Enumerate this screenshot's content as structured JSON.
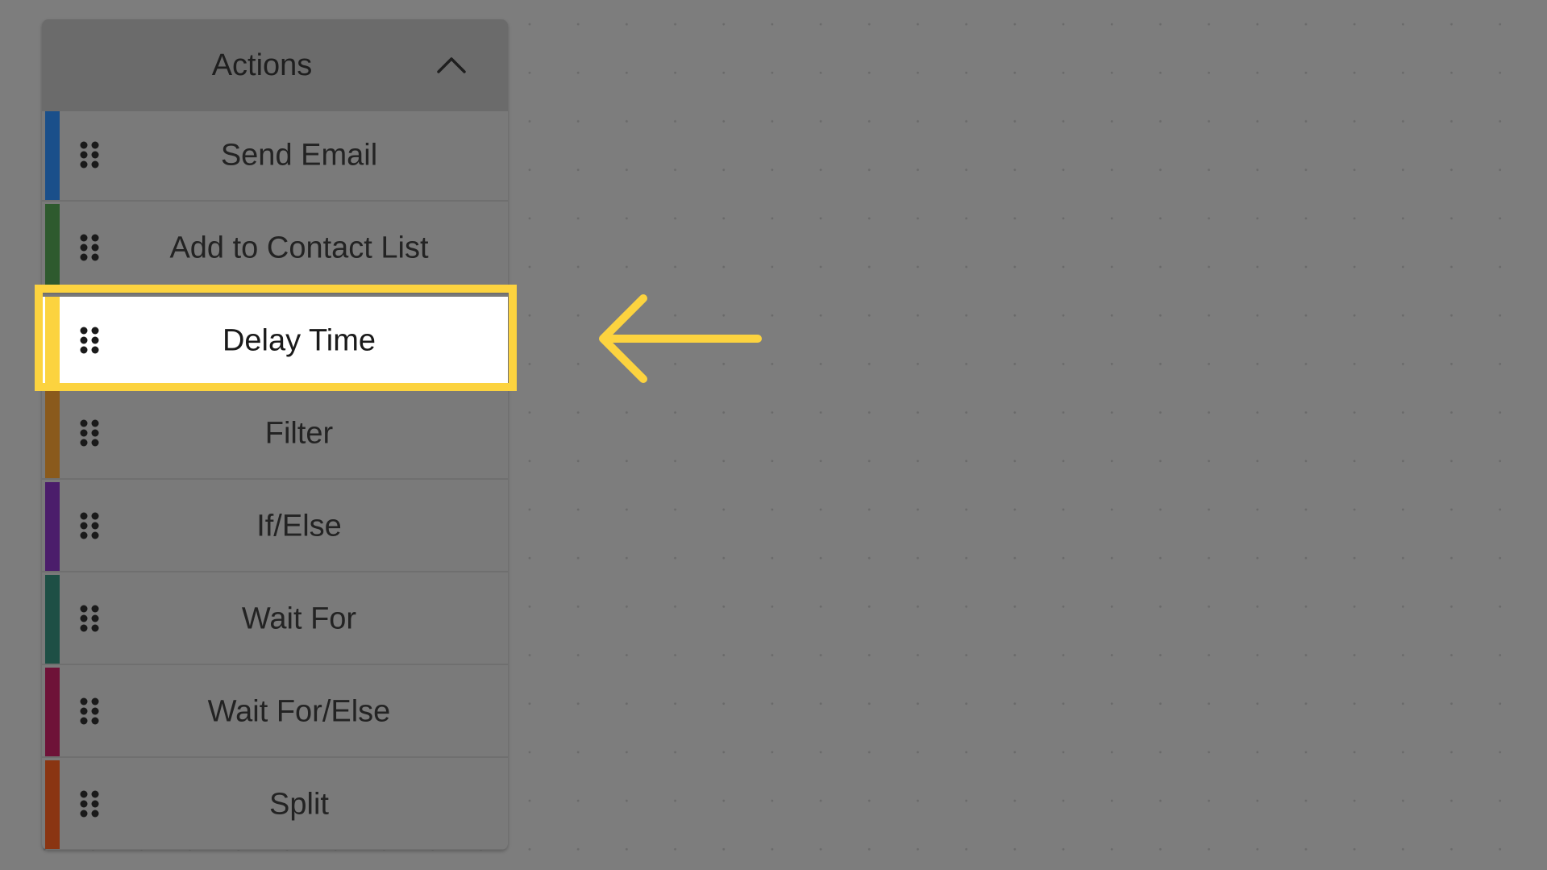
{
  "panel": {
    "title": "Actions",
    "toggle_icon": "chevron-up-icon"
  },
  "actions": [
    {
      "label": "Send Email",
      "color": "#1a4f8a",
      "highlighted": false
    },
    {
      "label": "Add to Contact List",
      "color": "#2e5a2e",
      "highlighted": false
    },
    {
      "label": "Delay Time",
      "color": "#fcd33f",
      "highlighted": true
    },
    {
      "label": "Filter",
      "color": "#8a5a1c",
      "highlighted": false
    },
    {
      "label": "If/Else",
      "color": "#4b1d6b",
      "highlighted": false
    },
    {
      "label": "Wait For",
      "color": "#1e4f45",
      "highlighted": false
    },
    {
      "label": "Wait For/Else",
      "color": "#6e1238",
      "highlighted": false
    },
    {
      "label": "Split",
      "color": "#8a3512",
      "highlighted": false
    }
  ],
  "annotation": {
    "highlight_color": "#fcd33f",
    "arrow_icon": "arrow-left-icon",
    "target": "Delay Time"
  }
}
